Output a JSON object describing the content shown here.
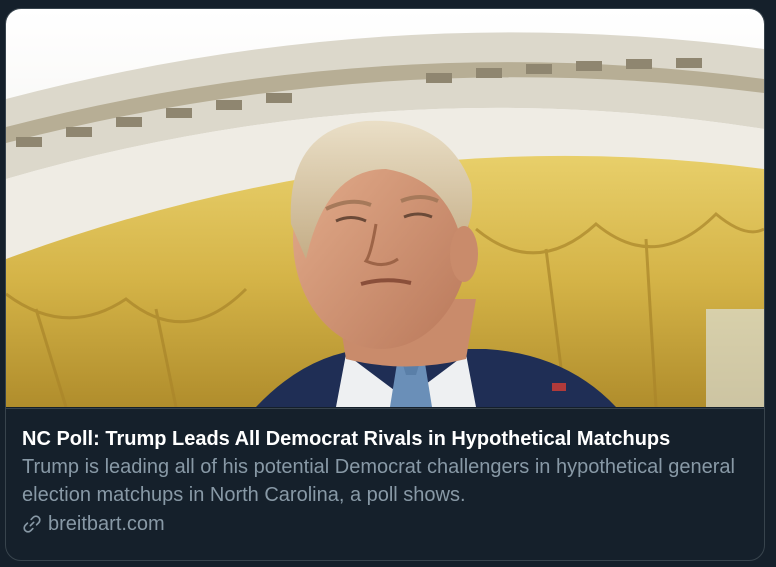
{
  "card": {
    "title": "NC Poll: Trump Leads All Democrat Rivals in Hypothetical Matchups",
    "description": "Trump is leading all of his potential Democrat challengers in hypothetical general election matchups in North Carolina, a poll shows.",
    "domain": "breitbart.com",
    "link_icon": "link-icon"
  },
  "colors": {
    "background": "#15202b",
    "border": "#38444d",
    "title": "#ffffff",
    "secondary_text": "#8899a6",
    "curtain_gold": "#d9b84a",
    "suit_navy": "#1f2e55",
    "tie_blue": "#6a8fb8"
  }
}
